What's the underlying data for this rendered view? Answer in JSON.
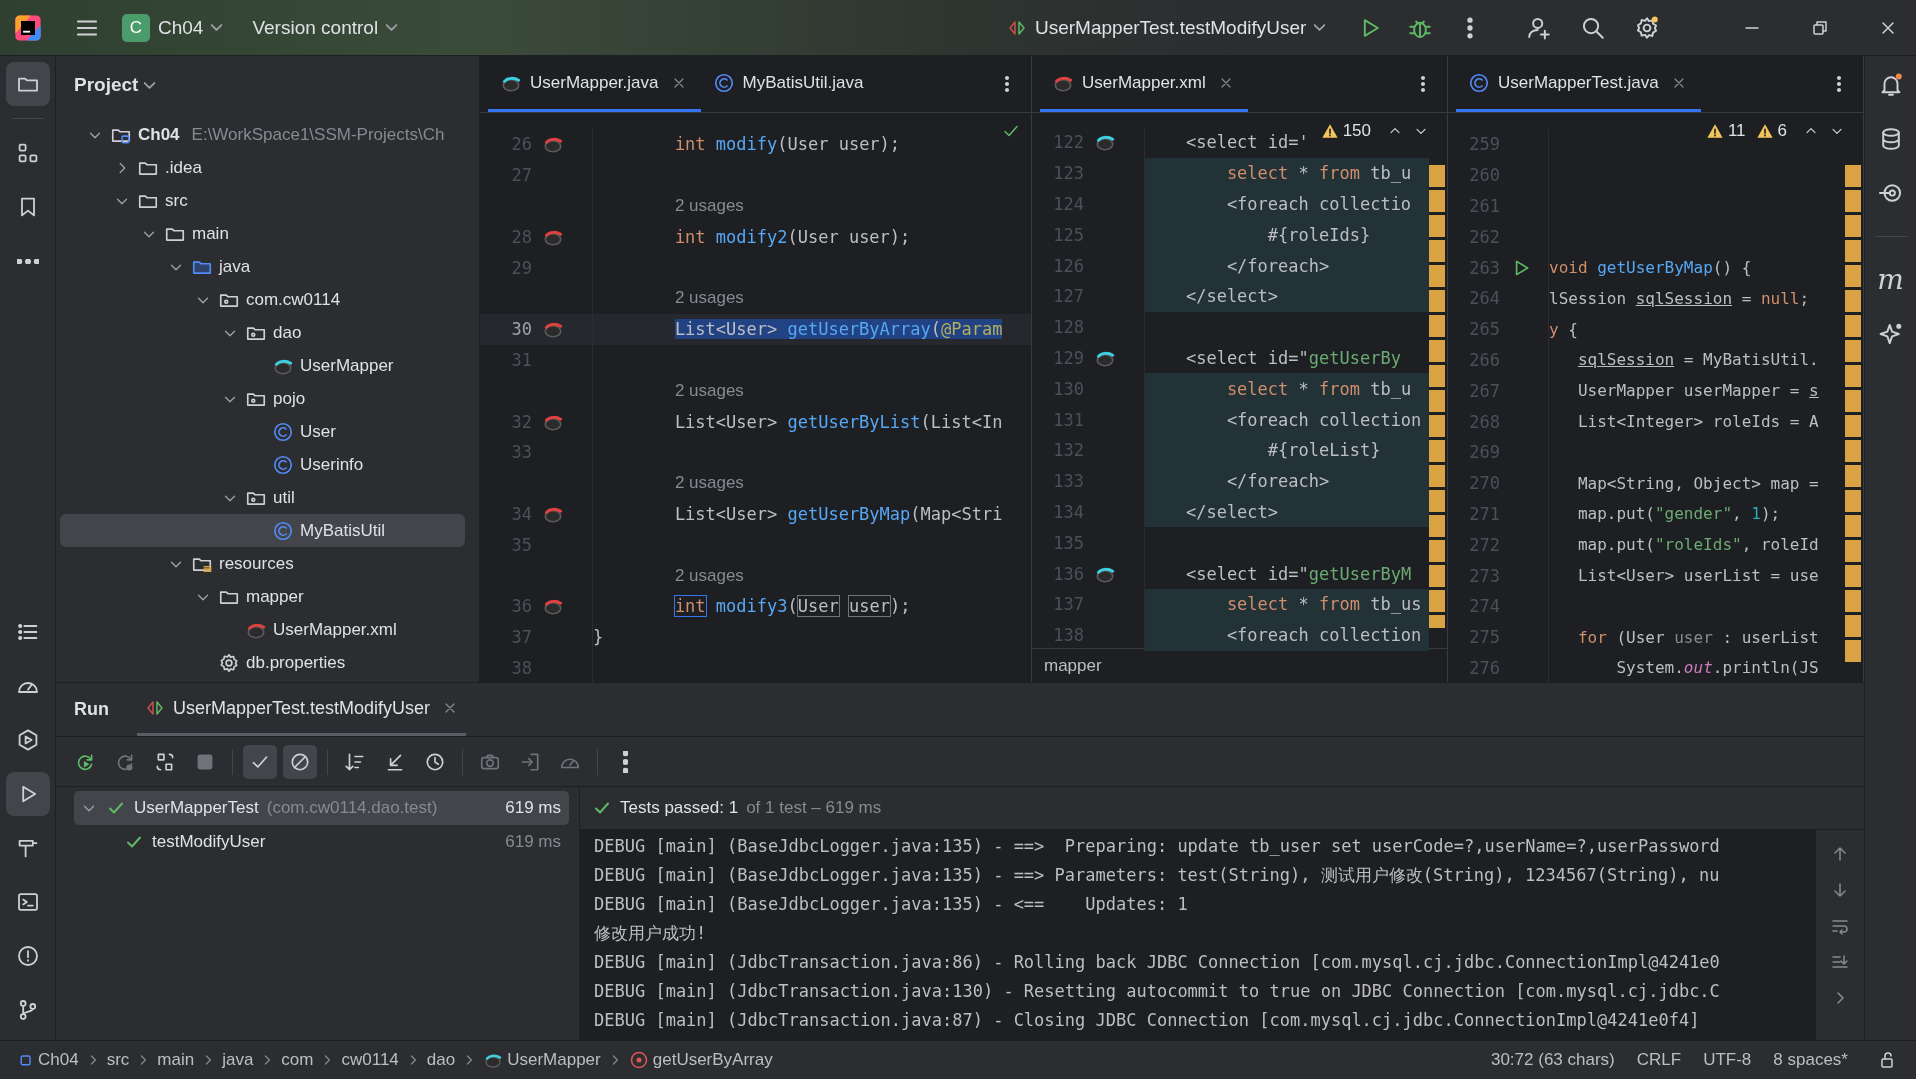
{
  "title_bar": {
    "project_badge": "C",
    "project": "Ch04",
    "vcs": "Version control",
    "run_config": "UserMapperTest.testModifyUser"
  },
  "left_toolbar": {
    "top": [
      {
        "kind": "folder",
        "selected": true
      },
      {
        "kind": "structure",
        "selected": false
      },
      {
        "kind": "bookmark",
        "selected": false
      },
      {
        "kind": "more",
        "selected": false
      }
    ],
    "bottom": [
      {
        "kind": "list",
        "selected": false
      },
      {
        "kind": "gauge",
        "selected": false
      },
      {
        "kind": "services",
        "selected": false
      },
      {
        "kind": "run",
        "selected": true
      },
      {
        "kind": "hammer",
        "selected": false
      },
      {
        "kind": "terminal",
        "selected": false
      },
      {
        "kind": "problems",
        "selected": false
      },
      {
        "kind": "branch",
        "selected": false
      }
    ]
  },
  "right_toolbar": [
    {
      "kind": "bell"
    },
    {
      "kind": "database"
    },
    {
      "kind": "target"
    },
    {
      "kind": "maven",
      "label": "m"
    },
    {
      "kind": "sparkle"
    }
  ],
  "project_panel": {
    "title": "Project",
    "tree": [
      {
        "label": "Ch04",
        "path": "E:\\WorkSpace1\\SSM-Projects\\Ch",
        "kind": "module",
        "expanded": true,
        "selected": false,
        "children": [
          {
            "label": ".idea",
            "kind": "folder",
            "expanded": false,
            "selected": false
          },
          {
            "label": "src",
            "kind": "folder",
            "expanded": true,
            "selected": false,
            "children": [
              {
                "label": "main",
                "kind": "folder",
                "expanded": true,
                "selected": false,
                "children": [
                  {
                    "label": "java",
                    "kind": "source",
                    "expanded": true,
                    "selected": false,
                    "children": [
                      {
                        "label": "com.cw0114",
                        "kind": "package",
                        "expanded": true,
                        "selected": false,
                        "children": [
                          {
                            "label": "dao",
                            "kind": "package",
                            "expanded": true,
                            "selected": false,
                            "children": [
                              {
                                "label": "UserMapper",
                                "kind": "mapper",
                                "selected": false
                              }
                            ]
                          },
                          {
                            "label": "pojo",
                            "kind": "package",
                            "expanded": true,
                            "selected": false,
                            "children": [
                              {
                                "label": "User",
                                "kind": "class",
                                "selected": false
                              },
                              {
                                "label": "Userinfo",
                                "kind": "class",
                                "selected": false
                              }
                            ]
                          },
                          {
                            "label": "util",
                            "kind": "package",
                            "expanded": true,
                            "selected": false,
                            "children": [
                              {
                                "label": "MyBatisUtil",
                                "kind": "class",
                                "selected": true
                              }
                            ]
                          }
                        ]
                      }
                    ]
                  },
                  {
                    "label": "resources",
                    "kind": "resources",
                    "expanded": true,
                    "selected": false,
                    "children": [
                      {
                        "label": "mapper",
                        "kind": "folder",
                        "expanded": true,
                        "selected": false,
                        "children": [
                          {
                            "label": "UserMapper.xml",
                            "kind": "xml",
                            "selected": false
                          }
                        ]
                      },
                      {
                        "label": "db.properties",
                        "kind": "properties",
                        "selected": false
                      }
                    ]
                  }
                ]
              }
            ]
          }
        ]
      }
    ]
  },
  "editors": [
    {
      "tabs": [
        {
          "label": "UserMapper.java",
          "kind": "mapper",
          "selected": true
        },
        {
          "label": "MyBatisUtil.java",
          "kind": "class",
          "selected": false
        }
      ],
      "lines": [
        {
          "number": "26",
          "gutter": {
            "kind": "mapper-red"
          },
          "current": false,
          "tokens": [
            {
              "text": "        int ",
              "kind": "keyword"
            },
            {
              "text": "modify",
              "kind": "method"
            },
            {
              "text": "(User user);",
              "kind": "plain"
            }
          ]
        },
        {
          "number": "27",
          "current": false
        },
        {
          "number": "28",
          "hint": "2 usages",
          "gutter": {
            "kind": "mapper-red"
          },
          "current": false,
          "tokens": [
            {
              "text": "        int ",
              "kind": "keyword"
            },
            {
              "text": "modify2",
              "kind": "method"
            },
            {
              "text": "(User user);",
              "kind": "plain"
            }
          ]
        },
        {
          "number": "29",
          "current": false
        },
        {
          "number": "30",
          "hint": "2 usages",
          "gutter": {
            "kind": "mapper-red"
          },
          "current": true,
          "tokens": [
            {
              "text": "        List<User> ",
              "kind": "plain"
            },
            {
              "text": "getUserByArray",
              "kind": "method"
            },
            {
              "text": "(",
              "kind": "plain"
            },
            {
              "text": "@Param",
              "kind": "annotation"
            }
          ]
        },
        {
          "number": "31",
          "current": false
        },
        {
          "number": "32",
          "hint": "2 usages",
          "gutter": {
            "kind": "mapper-red"
          },
          "current": false,
          "tokens": [
            {
              "text": "        List<User> ",
              "kind": "plain"
            },
            {
              "text": "getUserByList",
              "kind": "method"
            },
            {
              "text": "(List<In",
              "kind": "plain"
            }
          ]
        },
        {
          "number": "33",
          "current": false
        },
        {
          "number": "34",
          "hint": "2 usages",
          "gutter": {
            "kind": "mapper-red"
          },
          "current": false,
          "tokens": [
            {
              "text": "        List<User> ",
              "kind": "plain"
            },
            {
              "text": "getUserByMap",
              "kind": "method"
            },
            {
              "text": "(Map<Stri",
              "kind": "plain"
            }
          ]
        },
        {
          "number": "35",
          "current": false
        },
        {
          "number": "36",
          "hint": "2 usages",
          "gutter": {
            "kind": "mapper-red"
          },
          "current": false,
          "tokens": [
            {
              "text": "        int",
              "kind": "keyword-framed"
            },
            {
              "text": " modify3",
              "kind": "method"
            },
            {
              "text": "(",
              "kind": "plain"
            },
            {
              "text": "User",
              "kind": "plain-framed"
            },
            {
              "text": " user",
              "kind": "plain-framed"
            },
            {
              "text": ");",
              "kind": "plain"
            }
          ]
        },
        {
          "number": "37",
          "current": false,
          "tokens": [
            {
              "text": "}",
              "kind": "plain"
            }
          ]
        },
        {
          "number": "38",
          "current": false
        }
      ]
    },
    {
      "tabs": [
        {
          "label": "UserMapper.xml",
          "kind": "mapper-xml",
          "selected": true
        }
      ],
      "inspections": [
        "150"
      ],
      "lines": [
        {
          "number": "122",
          "gutter": {
            "kind": "mapper-cyan"
          },
          "injected": false,
          "tokens": [
            {
              "text": "    <select id='",
              "kind": "tag"
            }
          ]
        },
        {
          "number": "123",
          "injected": true,
          "tokens": [
            {
              "text": "        select",
              "kind": "sql"
            },
            {
              "text": " * ",
              "kind": "plain"
            },
            {
              "text": "from",
              "kind": "sql"
            },
            {
              "text": " tb_u",
              "kind": "plain"
            }
          ]
        },
        {
          "number": "124",
          "injected": true,
          "tokens": [
            {
              "text": "        <foreach collectio",
              "kind": "tag"
            }
          ]
        },
        {
          "number": "125",
          "injected": true,
          "tokens": [
            {
              "text": "            #{roleIds}",
              "kind": "plain"
            }
          ]
        },
        {
          "number": "126",
          "injected": true,
          "tokens": [
            {
              "text": "        </foreach>",
              "kind": "tag"
            }
          ]
        },
        {
          "number": "127",
          "injected": true,
          "tokens": [
            {
              "text": "    </select>",
              "kind": "tag"
            }
          ]
        },
        {
          "number": "128",
          "injected": false
        },
        {
          "number": "129",
          "gutter": {
            "kind": "mapper-cyan"
          },
          "injected": false,
          "tokens": [
            {
              "text": "    <select id=\"",
              "kind": "tag"
            },
            {
              "text": "getUserBy",
              "kind": "string"
            }
          ]
        },
        {
          "number": "130",
          "injected": true,
          "tokens": [
            {
              "text": "        select",
              "kind": "sql"
            },
            {
              "text": " * ",
              "kind": "plain"
            },
            {
              "text": "from",
              "kind": "sql"
            },
            {
              "text": " tb_u",
              "kind": "plain"
            }
          ]
        },
        {
          "number": "131",
          "injected": true,
          "tokens": [
            {
              "text": "        <foreach collection",
              "kind": "tag"
            }
          ]
        },
        {
          "number": "132",
          "injected": true,
          "tokens": [
            {
              "text": "            #{roleList}",
              "kind": "plain"
            }
          ]
        },
        {
          "number": "133",
          "injected": true,
          "tokens": [
            {
              "text": "        </foreach>",
              "kind": "tag"
            }
          ]
        },
        {
          "number": "134",
          "injected": true,
          "tokens": [
            {
              "text": "    </select>",
              "kind": "tag"
            }
          ]
        },
        {
          "number": "135",
          "injected": false
        },
        {
          "number": "136",
          "gutter": {
            "kind": "mapper-cyan"
          },
          "injected": false,
          "tokens": [
            {
              "text": "    <select id=\"",
              "kind": "tag"
            },
            {
              "text": "getUserByM",
              "kind": "string"
            }
          ]
        },
        {
          "number": "137",
          "injected": true,
          "tokens": [
            {
              "text": "        select",
              "kind": "sql"
            },
            {
              "text": " * ",
              "kind": "plain"
            },
            {
              "text": "from",
              "kind": "sql"
            },
            {
              "text": " tb_us",
              "kind": "plain"
            }
          ]
        },
        {
          "number": "138",
          "injected": true,
          "tokens": [
            {
              "text": "        <foreach collection",
              "kind": "tag"
            }
          ]
        }
      ],
      "breadcrumb": "mapper"
    },
    {
      "tabs": [
        {
          "label": "UserMapperTest.java",
          "kind": "class",
          "selected": true
        }
      ],
      "inspections": [
        "11",
        "6"
      ],
      "lines": [
        {
          "number": "259"
        },
        {
          "number": "260"
        },
        {
          "number": "261"
        },
        {
          "number": "262"
        },
        {
          "number": "263",
          "gutter": {
            "kind": "run"
          },
          "tokens": [
            {
              "text": "void ",
              "kind": "keyword"
            },
            {
              "text": "getUserByMap",
              "kind": "method"
            },
            {
              "text": "() {",
              "kind": "plain"
            }
          ]
        },
        {
          "number": "264",
          "tokens": [
            {
              "text": "lSession ",
              "kind": "plain"
            },
            {
              "text": "sqlSession",
              "kind": "underlined"
            },
            {
              "text": " = ",
              "kind": "plain"
            },
            {
              "text": "null",
              "kind": "keyword"
            },
            {
              "text": ";",
              "kind": "plain"
            }
          ]
        },
        {
          "number": "265",
          "tokens": [
            {
              "text": "y",
              "kind": "keyword"
            },
            {
              "text": " {",
              "kind": "plain"
            }
          ]
        },
        {
          "number": "266",
          "tokens": [
            {
              "text": "   sqlSession",
              "kind": "underlined"
            },
            {
              "text": " = MyBatisUtil.",
              "kind": "plain"
            }
          ]
        },
        {
          "number": "267",
          "tokens": [
            {
              "text": "   UserMapper userMapper = ",
              "kind": "plain"
            },
            {
              "text": "s",
              "kind": "underlined"
            }
          ]
        },
        {
          "number": "268",
          "tokens": [
            {
              "text": "   List<Integer> roleIds = A",
              "kind": "plain"
            }
          ]
        },
        {
          "number": "269"
        },
        {
          "number": "270",
          "tokens": [
            {
              "text": "   Map<String, Object> map =",
              "kind": "plain"
            }
          ]
        },
        {
          "number": "271",
          "tokens": [
            {
              "text": "   map.put(",
              "kind": "plain"
            },
            {
              "text": "\"gender\"",
              "kind": "string"
            },
            {
              "text": ", ",
              "kind": "plain"
            },
            {
              "text": "1",
              "kind": "number"
            },
            {
              "text": ");",
              "kind": "plain"
            }
          ]
        },
        {
          "number": "272",
          "tokens": [
            {
              "text": "   map.put(",
              "kind": "plain"
            },
            {
              "text": "\"roleIds\"",
              "kind": "string"
            },
            {
              "text": ", roleId",
              "kind": "plain"
            }
          ]
        },
        {
          "number": "273",
          "tokens": [
            {
              "text": "   List<User> userList = use",
              "kind": "plain"
            }
          ]
        },
        {
          "number": "274"
        },
        {
          "number": "275",
          "tokens": [
            {
              "text": "   for",
              "kind": "keyword"
            },
            {
              "text": " (User ",
              "kind": "plain"
            },
            {
              "text": "user",
              "kind": "unused"
            },
            {
              "text": " : userList",
              "kind": "plain"
            }
          ]
        },
        {
          "number": "276",
          "tokens": [
            {
              "text": "       System.",
              "kind": "plain"
            },
            {
              "text": "out",
              "kind": "field"
            },
            {
              "text": ".println(JS",
              "kind": "plain"
            }
          ]
        }
      ]
    }
  ],
  "run_panel": {
    "title": "Run",
    "tabs": [
      {
        "label": "UserMapperTest.testModifyUser",
        "selected": true
      }
    ],
    "toolbar": [
      {
        "kind": "rerun",
        "on": false,
        "disabled": false
      },
      {
        "kind": "rerun-failed",
        "on": false,
        "disabled": true
      },
      {
        "kind": "auto-test",
        "on": false,
        "disabled": false
      },
      {
        "kind": "stop",
        "on": false,
        "disabled": true
      },
      {
        "kind": "check",
        "on": true,
        "disabled": false
      },
      {
        "kind": "ignored",
        "on": true,
        "disabled": false
      },
      {
        "kind": "sort",
        "on": false,
        "disabled": false
      },
      {
        "kind": "collapse",
        "on": false,
        "disabled": false
      },
      {
        "kind": "history",
        "on": false,
        "disabled": false
      },
      {
        "kind": "camera",
        "on": false,
        "disabled": true
      },
      {
        "kind": "import",
        "on": false,
        "disabled": true
      },
      {
        "kind": "gauge",
        "on": false,
        "disabled": true
      },
      {
        "kind": "more-vertical",
        "on": false,
        "disabled": false
      }
    ],
    "tests": [
      {
        "name": "UserMapperTest",
        "package": "(com.cw0114.dao.test)",
        "time": "619 ms",
        "passed": true,
        "selected": true,
        "expanded": true,
        "children": [
          {
            "name": "testModifyUser",
            "time": "619 ms",
            "passed": true,
            "selected": false
          }
        ]
      }
    ],
    "summary": {
      "passed": true,
      "label": "Tests passed: 1",
      "detail": "of 1 test – 619 ms"
    },
    "console": [
      "DEBUG [main] (BaseJdbcLogger.java:135) - ==>  Preparing: update tb_user set userCode=?,userName=?,userPassword",
      "DEBUG [main] (BaseJdbcLogger.java:135) - ==> Parameters: test(String), 测试用户修改(String), 1234567(String), nu",
      "DEBUG [main] (BaseJdbcLogger.java:135) - <==    Updates: 1",
      "修改用户成功!",
      "DEBUG [main] (JdbcTransaction.java:86) - Rolling back JDBC Connection [com.mysql.cj.jdbc.ConnectionImpl@4241e0",
      "DEBUG [main] (JdbcTransaction.java:130) - Resetting autocommit to true on JDBC Connection [com.mysql.cj.jdbc.C",
      "DEBUG [main] (JdbcTransaction.java:87) - Closing JDBC Connection [com.mysql.cj.jdbc.ConnectionImpl@4241e0f4]"
    ]
  },
  "status_bar": {
    "breadcrumbs": [
      {
        "label": "Ch04",
        "kind": "module"
      },
      {
        "label": "src",
        "kind": "folder"
      },
      {
        "label": "main",
        "kind": "folder"
      },
      {
        "label": "java",
        "kind": "folder"
      },
      {
        "label": "com",
        "kind": "folder"
      },
      {
        "label": "cw0114",
        "kind": "folder"
      },
      {
        "label": "dao",
        "kind": "folder"
      },
      {
        "label": "UserMapper",
        "kind": "mapper"
      },
      {
        "label": "getUserByArray",
        "kind": "method"
      }
    ],
    "items": [
      "30:72 (63 chars)",
      "CRLF",
      "UTF-8",
      "8 spaces*"
    ]
  }
}
